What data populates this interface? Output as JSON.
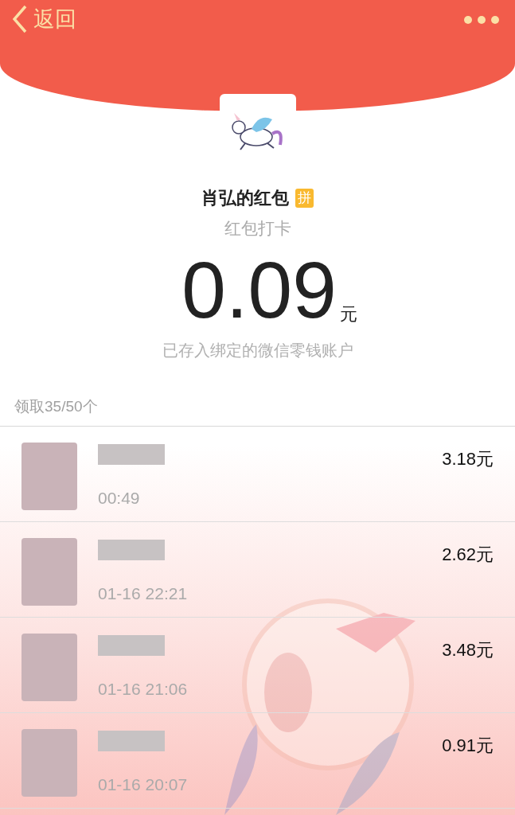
{
  "nav": {
    "back_label": "返回"
  },
  "sender": {
    "title": "肖弘的红包",
    "badge": "拼",
    "wish": "红包打卡"
  },
  "amount": {
    "value": "0.09",
    "unit": "元"
  },
  "note": "已存入绑定的微信零钱账户",
  "summary": "领取35/50个",
  "receivers": [
    {
      "time": "00:49",
      "amount": "3.18元"
    },
    {
      "time": "01-16 22:21",
      "amount": "2.62元"
    },
    {
      "time": "01-16 21:06",
      "amount": "3.48元"
    },
    {
      "time": "01-16 20:07",
      "amount": "0.91元"
    }
  ]
}
